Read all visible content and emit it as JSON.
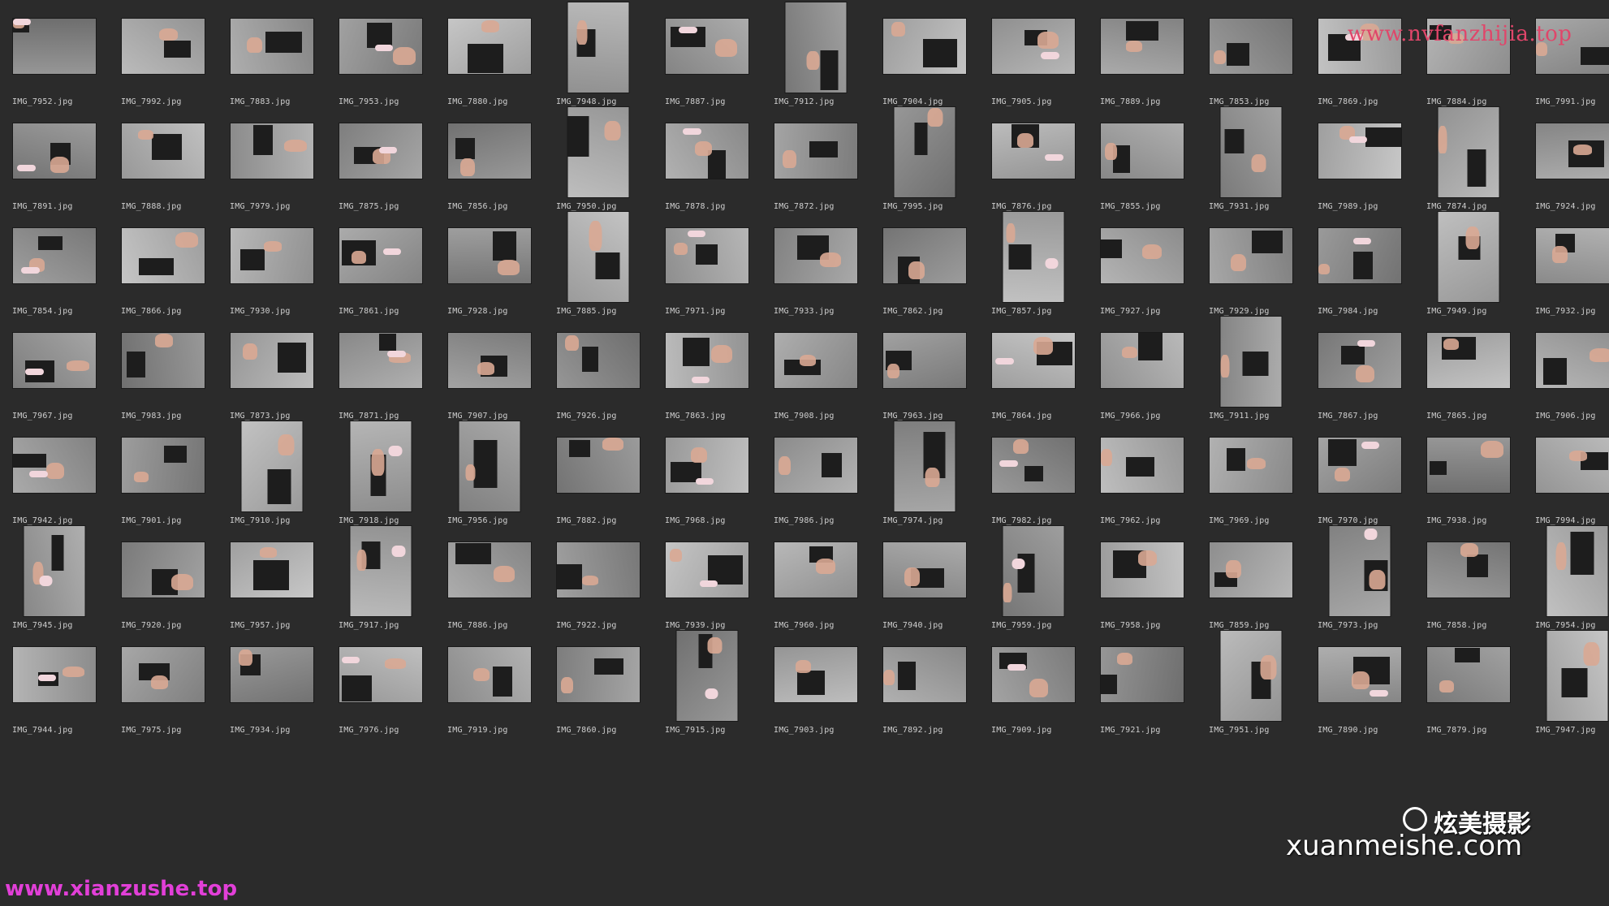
{
  "window": {
    "background": "#2b2b2b",
    "label_color": "#cfcfcf"
  },
  "files": [
    [
      "IMG_7952.jpg",
      "IMG_7992.jpg",
      "IMG_7883.jpg",
      "IMG_7953.jpg",
      "IMG_7880.jpg",
      "IMG_7948.jpg",
      "IMG_7887.jpg",
      "IMG_7912.jpg",
      "IMG_7904.jpg",
      "IMG_7905.jpg",
      "IMG_7889.jpg",
      "IMG_7853.jpg",
      "IMG_7869.jpg",
      "IMG_7884.jpg",
      "IMG_7991.jpg"
    ],
    [
      "IMG_7891.jpg",
      "IMG_7888.jpg",
      "IMG_7979.jpg",
      "IMG_7875.jpg",
      "IMG_7856.jpg",
      "IMG_7950.jpg",
      "IMG_7878.jpg",
      "IMG_7872.jpg",
      "IMG_7995.jpg",
      "IMG_7876.jpg",
      "IMG_7855.jpg",
      "IMG_7931.jpg",
      "IMG_7989.jpg",
      "IMG_7874.jpg",
      "IMG_7924.jpg"
    ],
    [
      "IMG_7854.jpg",
      "IMG_7866.jpg",
      "IMG_7930.jpg",
      "IMG_7861.jpg",
      "IMG_7928.jpg",
      "IMG_7885.jpg",
      "IMG_7971.jpg",
      "IMG_7933.jpg",
      "IMG_7862.jpg",
      "IMG_7857.jpg",
      "IMG_7927.jpg",
      "IMG_7929.jpg",
      "IMG_7984.jpg",
      "IMG_7949.jpg",
      "IMG_7932.jpg"
    ],
    [
      "IMG_7967.jpg",
      "IMG_7983.jpg",
      "IMG_7873.jpg",
      "IMG_7871.jpg",
      "IMG_7907.jpg",
      "IMG_7926.jpg",
      "IMG_7863.jpg",
      "IMG_7908.jpg",
      "IMG_7963.jpg",
      "IMG_7864.jpg",
      "IMG_7966.jpg",
      "IMG_7911.jpg",
      "IMG_7867.jpg",
      "IMG_7865.jpg",
      "IMG_7906.jpg"
    ],
    [
      "IMG_7942.jpg",
      "IMG_7901.jpg",
      "IMG_7910.jpg",
      "IMG_7918.jpg",
      "IMG_7956.jpg",
      "IMG_7882.jpg",
      "IMG_7968.jpg",
      "IMG_7986.jpg",
      "IMG_7974.jpg",
      "IMG_7982.jpg",
      "IMG_7962.jpg",
      "IMG_7969.jpg",
      "IMG_7970.jpg",
      "IMG_7938.jpg",
      "IMG_7994.jpg"
    ],
    [
      "IMG_7945.jpg",
      "IMG_7920.jpg",
      "IMG_7957.jpg",
      "IMG_7917.jpg",
      "IMG_7886.jpg",
      "IMG_7922.jpg",
      "IMG_7939.jpg",
      "IMG_7960.jpg",
      "IMG_7940.jpg",
      "IMG_7959.jpg",
      "IMG_7958.jpg",
      "IMG_7859.jpg",
      "IMG_7973.jpg",
      "IMG_7858.jpg",
      "IMG_7954.jpg"
    ],
    [
      "IMG_7944.jpg",
      "IMG_7975.jpg",
      "IMG_7934.jpg",
      "IMG_7976.jpg",
      "IMG_7919.jpg",
      "IMG_7860.jpg",
      "IMG_7915.jpg",
      "IMG_7903.jpg",
      "IMG_7892.jpg",
      "IMG_7909.jpg",
      "IMG_7921.jpg",
      "IMG_7951.jpg",
      "IMG_7890.jpg",
      "IMG_7879.jpg",
      "IMG_7947.jpg"
    ]
  ],
  "portrait": [
    [
      0,
      0,
      0,
      0,
      0,
      1,
      0,
      1,
      0,
      0,
      0,
      0,
      0,
      0,
      0
    ],
    [
      0,
      0,
      0,
      0,
      0,
      1,
      0,
      0,
      1,
      0,
      0,
      1,
      0,
      1,
      0
    ],
    [
      0,
      0,
      0,
      0,
      0,
      1,
      0,
      0,
      0,
      1,
      0,
      0,
      0,
      1,
      0
    ],
    [
      0,
      0,
      0,
      0,
      0,
      0,
      0,
      0,
      0,
      0,
      0,
      1,
      0,
      0,
      0
    ],
    [
      0,
      0,
      1,
      1,
      1,
      0,
      0,
      0,
      1,
      0,
      0,
      0,
      0,
      0,
      0
    ],
    [
      1,
      0,
      0,
      1,
      0,
      0,
      0,
      0,
      0,
      1,
      0,
      0,
      1,
      0,
      1
    ],
    [
      0,
      0,
      0,
      0,
      0,
      0,
      1,
      0,
      0,
      0,
      0,
      1,
      0,
      0,
      1
    ]
  ],
  "watermarks": {
    "top": "www.nvfanzhijia.top",
    "bottom_left": "www.xianzushe.top",
    "brand_cn": "炫美摄影",
    "brand_url": "xuanmeishe.com",
    "top_color": "#e0466a",
    "bottom_left_color": "#e23fd8"
  }
}
